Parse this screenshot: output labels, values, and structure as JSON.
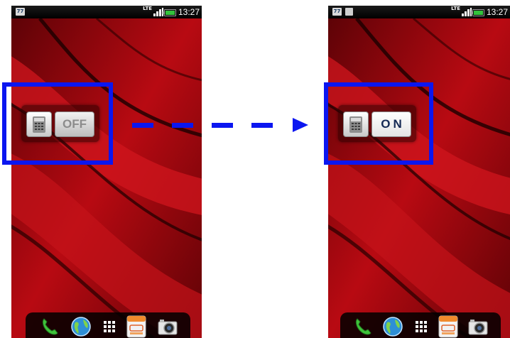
{
  "before": {
    "status_bar": {
      "notification_count": "77",
      "network_type": "LTE",
      "time": "13:27"
    },
    "widget": {
      "toggle_label": "OFF",
      "icon": "desk-phone-icon"
    },
    "dock": {
      "items": [
        "phone-icon",
        "browser-globe-icon",
        "app-drawer-icon",
        "passbook-icon",
        "camera-icon"
      ]
    }
  },
  "after": {
    "status_bar": {
      "notification_count": "77",
      "network_type": "LTE",
      "time": "13:27"
    },
    "widget": {
      "toggle_label": "ON",
      "icon": "desk-phone-icon"
    },
    "dock": {
      "items": [
        "phone-icon",
        "browser-globe-icon",
        "app-drawer-icon",
        "passbook-icon",
        "camera-icon"
      ]
    }
  },
  "colors": {
    "highlight": "#0b16f0",
    "wallpaper": "#b3090f",
    "toggle_on_text": "#162a55",
    "toggle_off_text": "#8c8c8c"
  }
}
